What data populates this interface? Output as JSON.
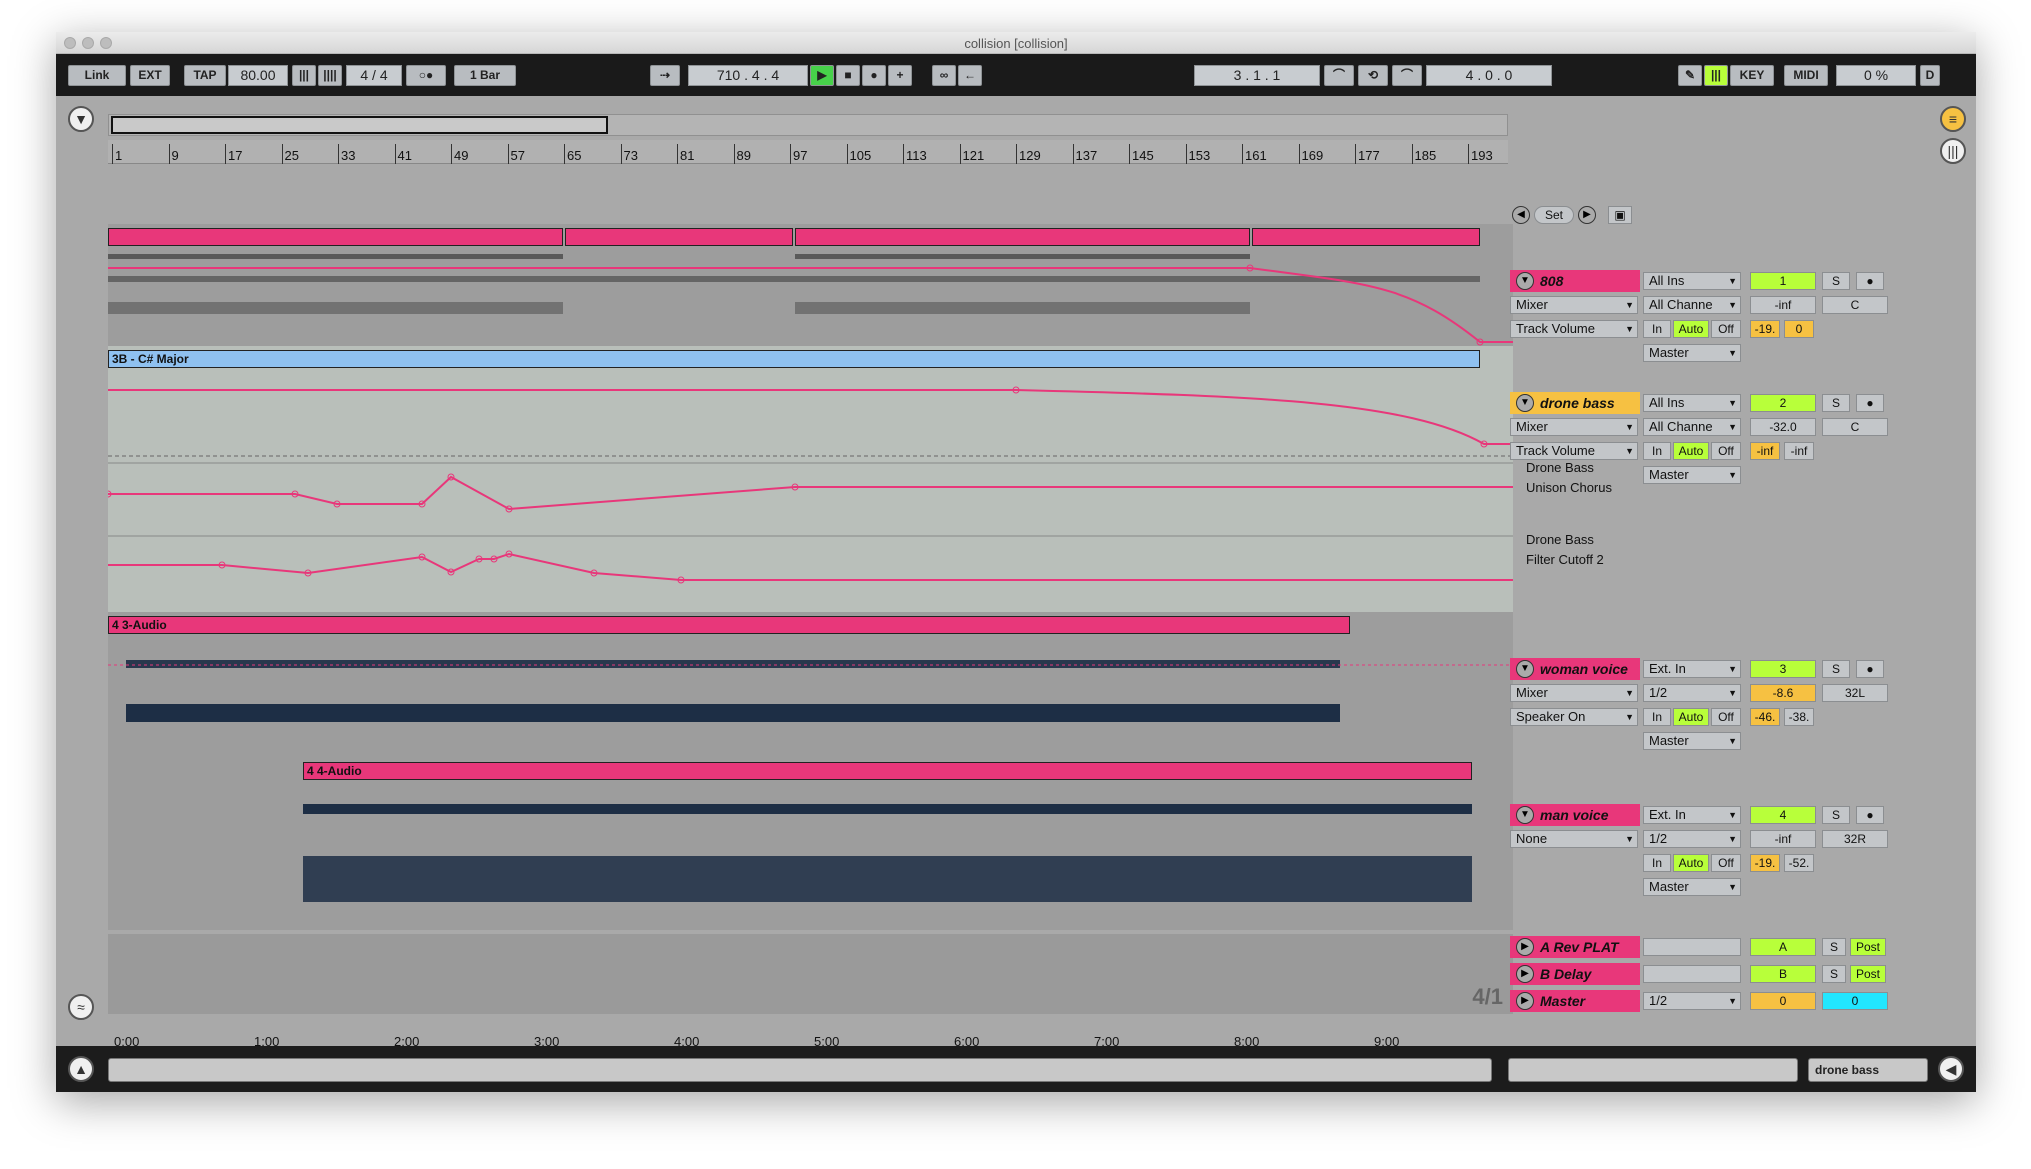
{
  "window": {
    "title": "collision  [collision]"
  },
  "transport": {
    "link": "Link",
    "ext": "EXT",
    "tap": "TAP",
    "tempo": "80.00",
    "sig": "4 / 4",
    "quant": "1 Bar",
    "position": "710 .  4 .  4",
    "loop_start": "3 .  1 .  1",
    "loop_len": "4 .  0 .  0",
    "key": "KEY",
    "midi": "MIDI",
    "cpu": "0 %",
    "d": "D"
  },
  "ruler": {
    "bars": [
      "1",
      "9",
      "17",
      "25",
      "33",
      "41",
      "49",
      "57",
      "65",
      "73",
      "81",
      "89",
      "97",
      "105",
      "113",
      "121",
      "129",
      "137",
      "145",
      "153",
      "161",
      "169",
      "177",
      "185",
      "193"
    ]
  },
  "timeline": {
    "times": [
      "0:00",
      "1:00",
      "2:00",
      "3:00",
      "4:00",
      "5:00",
      "6:00",
      "7:00",
      "8:00",
      "9:00"
    ],
    "grid": "4/1"
  },
  "locators": {
    "set": "Set"
  },
  "tracks": [
    {
      "name": "808",
      "input": "All Ins",
      "device": "Mixer",
      "channel": "All Channe",
      "param": "Track Volume",
      "monitor_in": "In",
      "monitor_auto": "Auto",
      "monitor_off": "Off",
      "output": "Master",
      "number": "1",
      "solo": "S",
      "volume": "-inf",
      "pan": "C",
      "meter_l": "-19.",
      "meter_r": "0"
    },
    {
      "name": "drone bass",
      "clip": "3B - C# Major",
      "input": "All Ins",
      "device": "Mixer",
      "channel": "All Channe",
      "param": "Track Volume",
      "monitor_in": "In",
      "monitor_auto": "Auto",
      "monitor_off": "Off",
      "output": "Master",
      "number": "2",
      "solo": "S",
      "volume": "-32.0",
      "pan": "C",
      "meter_l": "-inf",
      "meter_r": "-inf",
      "lane1_device": "Drone Bass",
      "lane1_param": "Unison Chorus",
      "lane2_device": "Drone Bass",
      "lane2_param": "Filter Cutoff 2"
    },
    {
      "name": "woman voice",
      "clip": "4 3-Audio",
      "input": "Ext. In",
      "device": "Mixer",
      "channel": "1/2",
      "param": "Speaker On",
      "monitor_in": "In",
      "monitor_auto": "Auto",
      "monitor_off": "Off",
      "output": "Master",
      "number": "3",
      "solo": "S",
      "volume": "-8.6",
      "pan": "32L",
      "meter_l": "-46.",
      "meter_r": "-38."
    },
    {
      "name": "man voice",
      "clip": "4 4-Audio",
      "input": "Ext. In",
      "device": "None",
      "channel": "1/2",
      "monitor_in": "In",
      "monitor_auto": "Auto",
      "monitor_off": "Off",
      "output": "Master",
      "number": "4",
      "solo": "S",
      "volume": "-inf",
      "pan": "32R",
      "meter_l": "-19.",
      "meter_r": "-52."
    }
  ],
  "returns": [
    {
      "name": "A Rev PLAT",
      "letter": "A",
      "solo": "S",
      "post": "Post"
    },
    {
      "name": "B Delay",
      "letter": "B",
      "solo": "S",
      "post": "Post"
    }
  ],
  "master": {
    "name": "Master",
    "channel": "1/2",
    "volume": "0",
    "pan": "0"
  },
  "status": {
    "selected": "drone bass"
  }
}
